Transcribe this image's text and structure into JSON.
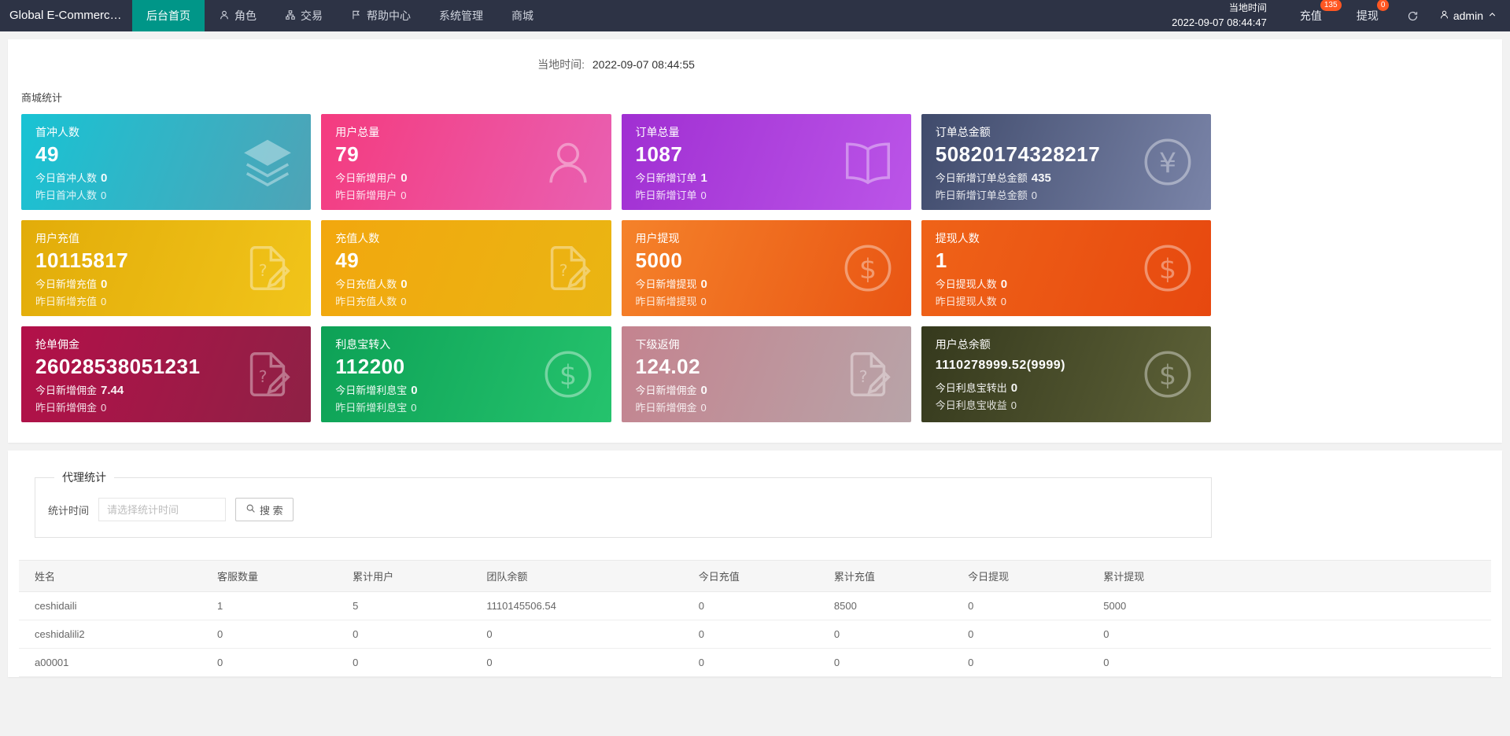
{
  "colors": {
    "navbar_bg": "#2d3345",
    "active_tab": "#009688",
    "badge": "#ff5722",
    "page_bg": "#f2f2f2"
  },
  "navbar": {
    "brand": "Global E-Commerce...",
    "items": [
      {
        "label": "后台首页"
      },
      {
        "label": "角色"
      },
      {
        "label": "交易"
      },
      {
        "label": "帮助中心"
      },
      {
        "label": "系统管理"
      },
      {
        "label": "商城"
      }
    ],
    "local_time_label": "当地时间",
    "local_time": "2022-09-07 08:44:47",
    "recharge_label": "充值",
    "recharge_badge": "135",
    "withdraw_label": "提现",
    "withdraw_badge": "0",
    "username": "admin"
  },
  "overview": {
    "time_label": "当地时间:",
    "time_value": "2022-09-07 08:44:55",
    "section_title": "商城统计",
    "cards": [
      {
        "title": "首冲人数",
        "value": "49",
        "line1_label": "今日首冲人数",
        "line1_value": "0",
        "line2_label": "昨日首冲人数",
        "line2_value": "0",
        "icon": "layers",
        "gradient": [
          "#18c3d4",
          "#4fa3b6"
        ]
      },
      {
        "title": "用户总量",
        "value": "79",
        "line1_label": "今日新增用户",
        "line1_value": "0",
        "line2_label": "昨日新增用户",
        "line2_value": "0",
        "icon": "user",
        "gradient": [
          "#f43b7f",
          "#e960b2"
        ]
      },
      {
        "title": "订单总量",
        "value": "1087",
        "line1_label": "今日新增订单",
        "line1_value": "1",
        "line2_label": "昨日新增订单",
        "line2_value": "0",
        "icon": "book",
        "gradient": [
          "#a02fd2",
          "#bb55e8"
        ]
      },
      {
        "title": "订单总金额",
        "value": "50820174328217",
        "line1_label": "今日新增订单总金额",
        "line1_value": "435",
        "line2_label": "昨日新增订单总金额",
        "line2_value": "0",
        "icon": "yen",
        "gradient": [
          "#3f4a6b",
          "#7a84a8"
        ]
      },
      {
        "title": "用户充值",
        "value": "10115817",
        "line1_label": "今日新增充值",
        "line1_value": "0",
        "line2_label": "昨日新增充值",
        "line2_value": "0",
        "icon": "doc",
        "gradient": [
          "#e2ac09",
          "#f1c41a"
        ]
      },
      {
        "title": "充值人数",
        "value": "49",
        "line1_label": "今日充值人数",
        "line1_value": "0",
        "line2_label": "昨日充值人数",
        "line2_value": "0",
        "icon": "doc",
        "gradient": [
          "#f2a70e",
          "#eab513"
        ]
      },
      {
        "title": "用户提现",
        "value": "5000",
        "line1_label": "今日新增提现",
        "line1_value": "0",
        "line2_label": "昨日新增提现",
        "line2_value": "0",
        "icon": "dollar",
        "gradient": [
          "#f5822a",
          "#e95513"
        ]
      },
      {
        "title": "提现人数",
        "value": "1",
        "line1_label": "今日提现人数",
        "line1_value": "0",
        "line2_label": "昨日提现人数",
        "line2_value": "0",
        "icon": "dollar",
        "gradient": [
          "#ef6318",
          "#e7480f"
        ]
      },
      {
        "title": "抢单佣金",
        "value": "26028538051231",
        "line1_label": "今日新增佣金",
        "line1_value": "7.44",
        "line2_label": "昨日新增佣金",
        "line2_value": "0",
        "icon": "doc",
        "gradient": [
          "#b31049",
          "#8e2145"
        ]
      },
      {
        "title": "利息宝转入",
        "value": "112200",
        "line1_label": "今日新增利息宝",
        "line1_value": "0",
        "line2_label": "昨日新增利息宝",
        "line2_value": "0",
        "icon": "dollar",
        "gradient": [
          "#0da156",
          "#25c36d"
        ]
      },
      {
        "title": "下级返佣",
        "value": "124.02",
        "line1_label": "今日新增佣金",
        "line1_value": "0",
        "line2_label": "昨日新增佣金",
        "line2_value": "0",
        "icon": "doc",
        "gradient": [
          "#c4838f",
          "#b8a4a8"
        ]
      },
      {
        "title": "用户总余额",
        "value": "1110278999.52(9999)",
        "line1_label": "今日利息宝转出",
        "line1_value": "0",
        "line2_label": "今日利息宝收益",
        "line2_value": "0",
        "icon": "dollar",
        "gradient": [
          "#35391d",
          "#5e6238"
        ]
      }
    ]
  },
  "agent": {
    "legend": "代理统计",
    "time_field_label": "统计时间",
    "time_placeholder": "请选择统计时间",
    "search_label": "搜 索",
    "table": {
      "headers": [
        "姓名",
        "客服数量",
        "累计用户",
        "团队余额",
        "今日充值",
        "累计充值",
        "今日提现",
        "累计提现"
      ],
      "rows": [
        [
          "ceshidaili",
          "1",
          "5",
          "1110145506.54",
          "0",
          "8500",
          "0",
          "5000"
        ],
        [
          "ceshidalili2",
          "0",
          "0",
          "0",
          "0",
          "0",
          "0",
          "0"
        ],
        [
          "a00001",
          "0",
          "0",
          "0",
          "0",
          "0",
          "0",
          "0"
        ]
      ]
    }
  }
}
